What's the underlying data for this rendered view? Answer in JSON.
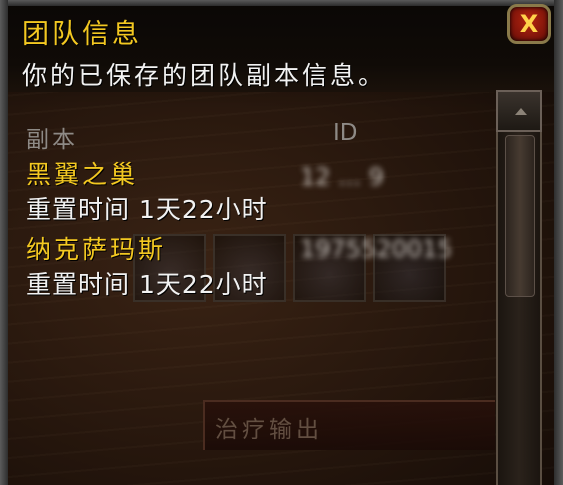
{
  "window": {
    "title": "团队信息",
    "subtitle": "你的已保存的团队副本信息。",
    "close_label": "X"
  },
  "columns": {
    "instance": "副本",
    "id": "ID"
  },
  "instances": [
    {
      "name": "黑翼之巢",
      "reset": "重置时间 1天22小时",
      "id": "12 ... 9"
    },
    {
      "name": "纳克萨玛斯",
      "reset": "重置时间 1天22小时",
      "id": "1975520015"
    }
  ],
  "background_bar": {
    "label": "治疗输出"
  },
  "colors": {
    "title": "#f3c821",
    "text": "#f2f2f2",
    "header_text": "#8e8a86",
    "close_button": "#b3240f"
  }
}
